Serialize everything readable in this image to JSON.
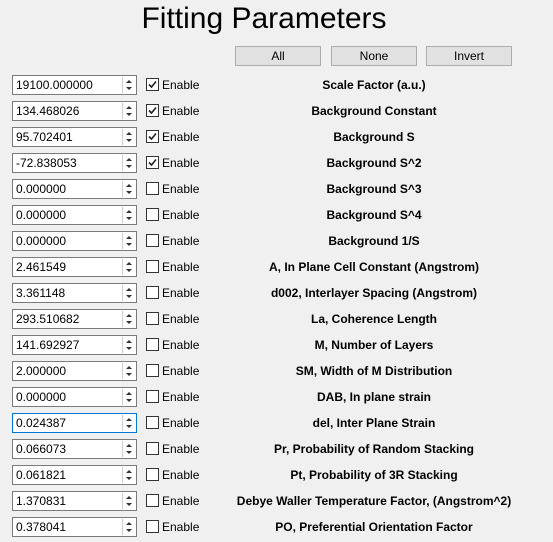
{
  "title": "Fitting Parameters",
  "buttons": {
    "all": "All",
    "none": "None",
    "invert": "Invert"
  },
  "enable_label": "Enable",
  "parameters": [
    {
      "value": "19100.000000",
      "enabled": true,
      "label": "Scale Factor (a.u.)"
    },
    {
      "value": "134.468026",
      "enabled": true,
      "label": "Background Constant"
    },
    {
      "value": "95.702401",
      "enabled": true,
      "label": "Background S"
    },
    {
      "value": "-72.838053",
      "enabled": true,
      "label": "Background S^2"
    },
    {
      "value": "0.000000",
      "enabled": false,
      "label": "Background S^3"
    },
    {
      "value": "0.000000",
      "enabled": false,
      "label": "Background S^4"
    },
    {
      "value": "0.000000",
      "enabled": false,
      "label": "Background 1/S"
    },
    {
      "value": "2.461549",
      "enabled": false,
      "label": "A, In Plane Cell Constant (Angstrom)"
    },
    {
      "value": "3.361148",
      "enabled": false,
      "label": "d002, Interlayer Spacing (Angstrom)"
    },
    {
      "value": "293.510682",
      "enabled": false,
      "label": "La, Coherence Length"
    },
    {
      "value": "141.692927",
      "enabled": false,
      "label": "M, Number of Layers"
    },
    {
      "value": "2.000000",
      "enabled": false,
      "label": "SM, Width of M Distribution"
    },
    {
      "value": "0.000000",
      "enabled": false,
      "label": "DAB, In plane strain"
    },
    {
      "value": "0.024387",
      "enabled": false,
      "label": "del, Inter Plane Strain",
      "focused": true
    },
    {
      "value": "0.066073",
      "enabled": false,
      "label": "Pr, Probability of Random Stacking"
    },
    {
      "value": "0.061821",
      "enabled": false,
      "label": "Pt, Probability of 3R Stacking"
    },
    {
      "value": "1.370831",
      "enabled": false,
      "label": "Debye Waller Temperature Factor, (Angstrom^2)"
    },
    {
      "value": "0.378041",
      "enabled": false,
      "label": "PO, Preferential Orientation Factor"
    }
  ]
}
